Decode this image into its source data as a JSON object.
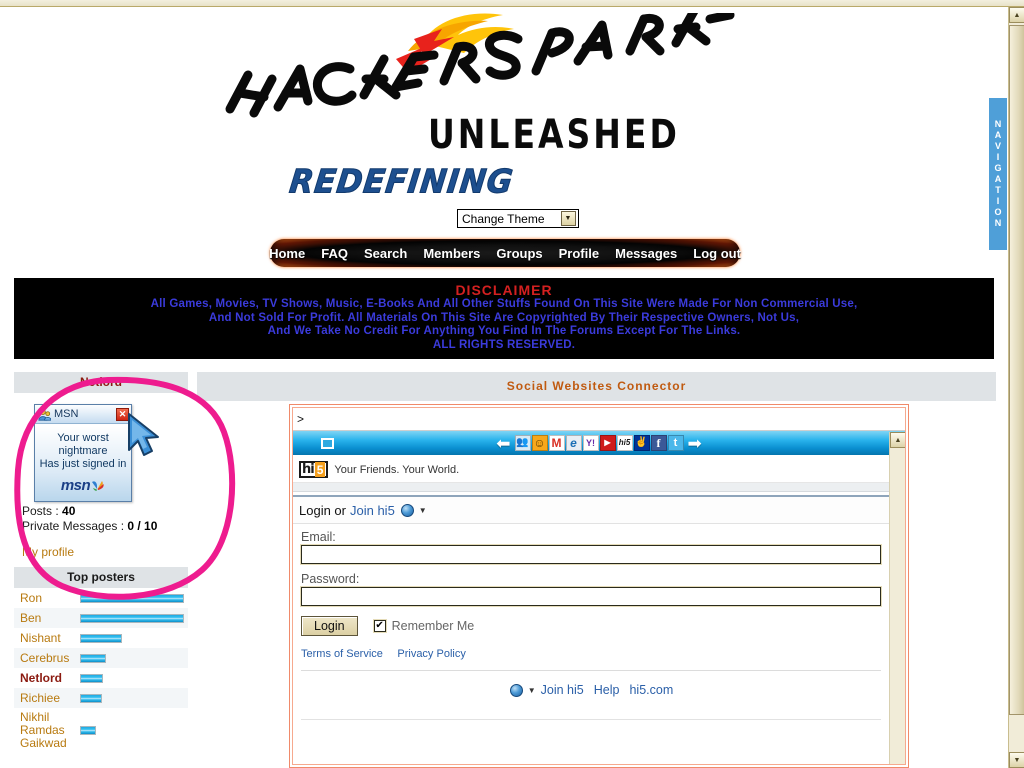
{
  "site": {
    "logo_main": "HACKERSPARK",
    "logo_sub": "UNLEASHED",
    "logo_tagline": "REDEFINING"
  },
  "theme": {
    "selected": "Change Theme",
    "arrow": "▼"
  },
  "nav": {
    "items": [
      {
        "label": "Home"
      },
      {
        "label": "FAQ"
      },
      {
        "label": "Search"
      },
      {
        "label": "Members"
      },
      {
        "label": "Groups"
      },
      {
        "label": "Profile"
      },
      {
        "label": "Messages"
      },
      {
        "label": "Log out"
      }
    ]
  },
  "disclaimer": {
    "title": "DISCLAIMER",
    "lines": [
      "All Games, Movies, TV Shows, Music, E-Books And All Other Stuffs Found On This Site Were Made For Non Commercial Use,",
      "And Not Sold For Profit. All Materials On This Site Are Copyrighted By Their Respective Owners, Not Us,",
      "And We Take No Credit For Anything You Find In The Forums Except For The Links.",
      "ALL RIGHTS RESERVED."
    ],
    "title_color": "#d42020",
    "text_color": "#3b3bdc",
    "bg_color": "#000000"
  },
  "sidebar": {
    "user_panel_title": "Netlord",
    "msn_toast": {
      "title": "MSN",
      "close": "✕",
      "message_lines": [
        "Your worst",
        "nightmare",
        "Has just signed in"
      ],
      "brand": "msn"
    },
    "stats": {
      "posts_label": "Posts : ",
      "posts_value": "40",
      "pm_label": "Private Messages : ",
      "pm_value": "0 / 10"
    },
    "my_profile": "My profile",
    "top_posters_title": "Top posters",
    "top_posters": [
      {
        "name": "Ron",
        "bar": 104
      },
      {
        "name": "Ben",
        "bar": 104
      },
      {
        "name": "Nishant",
        "bar": 42
      },
      {
        "name": "Cerebrus",
        "bar": 26
      },
      {
        "name": "Netlord",
        "bar": 23,
        "current": true
      },
      {
        "name": "Richiee",
        "bar": 22
      },
      {
        "name": "Nikhil Ramdas Gaikwad",
        "bar": 16
      }
    ]
  },
  "main": {
    "title": "Social Websites Connector",
    "address_value": ">",
    "toolbar": {
      "back_arrow": "⬅",
      "forward_arrow": "➡",
      "icons": [
        {
          "name": "msn-messenger-icon",
          "glyph": "👥",
          "bg": "#d7eaf6",
          "fg": "#1a5a9e"
        },
        {
          "name": "yahoo-messenger-icon",
          "glyph": "☺",
          "bg": "#f7a81b",
          "fg": "#5a3a00"
        },
        {
          "name": "gmail-icon",
          "glyph": "M",
          "bg": "#ffffff",
          "fg": "#d93025"
        },
        {
          "name": "internet-explorer-icon",
          "glyph": "e",
          "bg": "#e8eef4",
          "fg": "#1b6fb5"
        },
        {
          "name": "yahoo-mail-icon",
          "glyph": "Y!",
          "bg": "#ffffff",
          "fg": "#6b2da8"
        },
        {
          "name": "youtube-icon",
          "glyph": "▶",
          "bg": "#cf1b1b",
          "fg": "#ffffff"
        },
        {
          "name": "hi5-icon",
          "glyph": "hi5",
          "bg": "#ffffff",
          "fg": "#1a1a1a"
        },
        {
          "name": "myspace-icon",
          "glyph": "✌",
          "bg": "#003399",
          "fg": "#ffffff"
        },
        {
          "name": "facebook-icon",
          "glyph": "f",
          "bg": "#3b5998",
          "fg": "#ffffff"
        },
        {
          "name": "twitter-icon",
          "glyph": "t",
          "bg": "#4bb7ea",
          "fg": "#ffffff"
        }
      ]
    }
  },
  "hi5": {
    "logo_hi": "hi",
    "logo_5": "5",
    "tagline": "Your Friends. Your World.",
    "login_prefix": "Login or",
    "join_link": "Join hi5",
    "caret": "▼",
    "email_label": "Email:",
    "email_value": "",
    "password_label": "Password:",
    "password_value": "",
    "login_button": "Login",
    "remember_checked": "✔",
    "remember_label": "Remember Me",
    "terms_link": "Terms of Service",
    "privacy_link": "Privacy Policy",
    "footer_links": [
      "Join hi5",
      "Help",
      "hi5.com"
    ]
  },
  "right_tab": {
    "label": "NAVIGATION",
    "letters": [
      "N",
      "A",
      "V",
      "I",
      "G",
      "A",
      "T",
      "I",
      "O",
      "N"
    ],
    "color": "#4f9fd8"
  },
  "scrollbar": {
    "up_arrow": "▲",
    "down_arrow": "▼"
  },
  "annotations": {
    "circle_color": "#ee1c8f",
    "cursor": "arrow-pointer"
  }
}
